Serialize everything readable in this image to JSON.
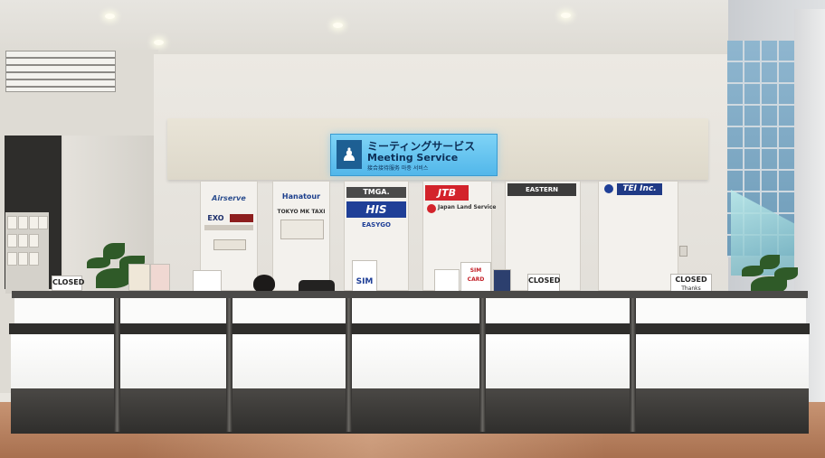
{
  "signage": {
    "main_ja": "ミーティングサービス",
    "main_en": "Meeting Service",
    "main_multi": "接合接待服务  마중 서비스",
    "closed_label": "CLOSED",
    "closed_note": "Thanks",
    "sim_label": "SIM",
    "sim_card_label": "SIM CARD"
  },
  "agencies": {
    "airserve": "Airserve",
    "exo": "EXO",
    "hanatour": "Hanatour",
    "tokyo_mk_taxi": "TOKYO MK TAXI",
    "tmga": "TMGA.",
    "his": "HIS",
    "easygo": "EASYGO",
    "jtb": "JTB",
    "japan_land_service": "Japan Land Service",
    "eastern": "EASTERN",
    "tei": "TEI Inc."
  }
}
